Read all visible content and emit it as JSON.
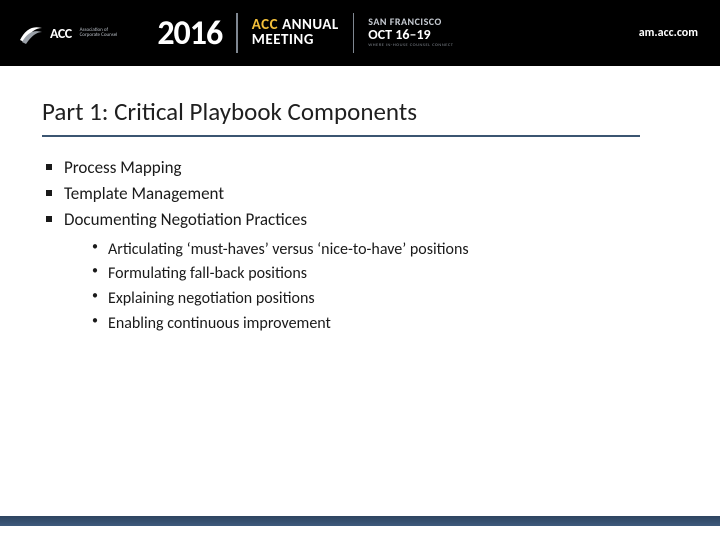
{
  "header": {
    "logo": {
      "acc_text": "ACC",
      "acc_sub_line1": "Association of",
      "acc_sub_line2": "Corporate Counsel"
    },
    "year": "2016",
    "brand_line1_accent": "ACC",
    "brand_line2": "ANNUAL",
    "brand_line3": "MEETING",
    "city": "SAN FRANCISCO",
    "date": "OCT 16–19",
    "tag": "WHERE IN-HOUSE COUNSEL CONNECT",
    "url": "am.acc.com"
  },
  "slide": {
    "title": "Part 1: Critical Playbook Components",
    "bullets": [
      "Process Mapping",
      "Template Management",
      "Documenting Negotiation Practices"
    ],
    "sub_bullets": [
      "Articulating ‘must-haves’ versus ‘nice-to-have’ positions",
      "Formulating fall-back positions",
      "Explaining negotiation positions",
      "Enabling continuous improvement"
    ]
  }
}
